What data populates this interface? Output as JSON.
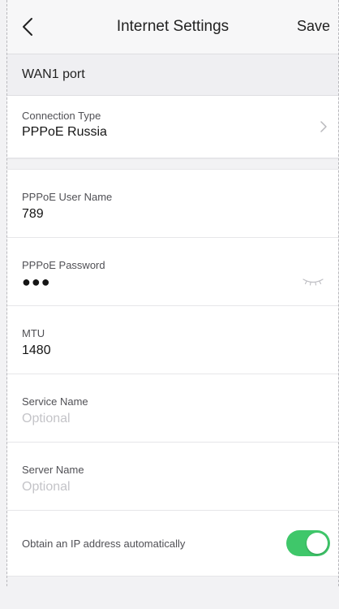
{
  "header": {
    "title": "Internet Settings",
    "save_label": "Save",
    "back_icon": "chevron-left-icon"
  },
  "section": {
    "title": "WAN1 port"
  },
  "connection": {
    "label": "Connection Type",
    "value": "PPPoE Russia",
    "icon": "chevron-right-icon"
  },
  "fields": {
    "username": {
      "label": "PPPoE User Name",
      "value": "789"
    },
    "password": {
      "label": "PPPoE Password",
      "value": "●●●",
      "icon": "eye-closed-icon"
    },
    "mtu": {
      "label": "MTU",
      "value": "1480"
    },
    "service_name": {
      "label": "Service Name",
      "placeholder": "Optional"
    },
    "server_name": {
      "label": "Server Name",
      "placeholder": "Optional"
    }
  },
  "obtain_ip": {
    "label": "Obtain an IP address automatically",
    "enabled": true,
    "color": "#3fc76a"
  }
}
